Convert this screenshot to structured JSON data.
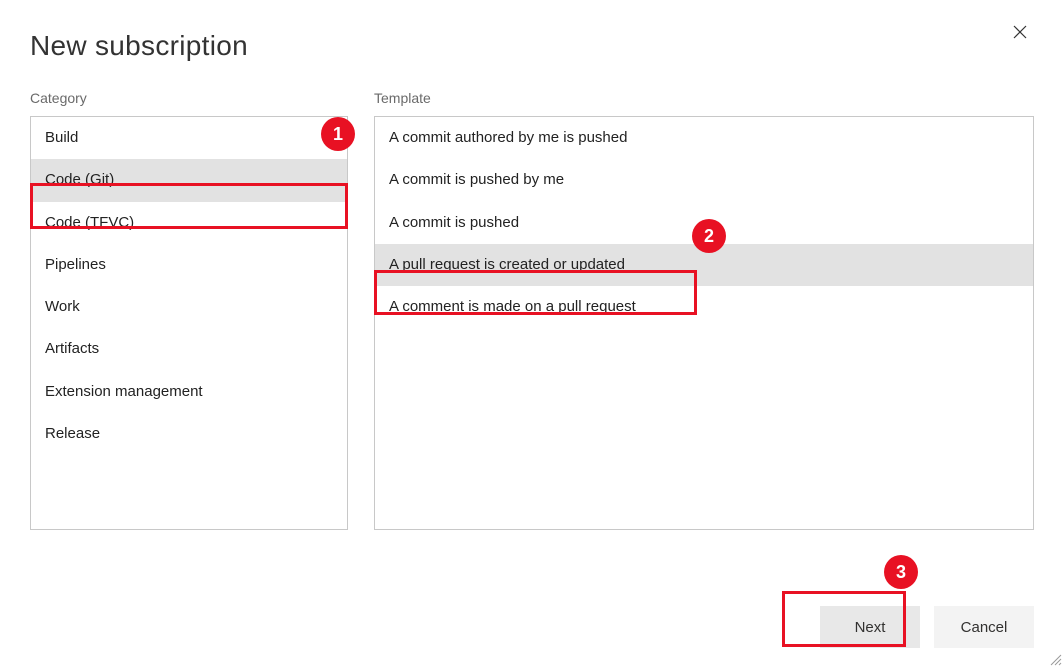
{
  "dialog": {
    "title": "New subscription"
  },
  "category": {
    "label": "Category",
    "items": [
      {
        "label": "Build"
      },
      {
        "label": "Code (Git)"
      },
      {
        "label": "Code (TFVC)"
      },
      {
        "label": "Pipelines"
      },
      {
        "label": "Work"
      },
      {
        "label": "Artifacts"
      },
      {
        "label": "Extension management"
      },
      {
        "label": "Release"
      }
    ],
    "selected_index": 1
  },
  "template": {
    "label": "Template",
    "items": [
      {
        "label": "A commit authored by me is pushed"
      },
      {
        "label": "A commit is pushed by me"
      },
      {
        "label": "A commit is pushed"
      },
      {
        "label": "A pull request is created or updated"
      },
      {
        "label": "A comment is made on a pull request"
      }
    ],
    "selected_index": 3
  },
  "buttons": {
    "next": "Next",
    "cancel": "Cancel"
  },
  "annotations": {
    "b1": "1",
    "b2": "2",
    "b3": "3"
  }
}
